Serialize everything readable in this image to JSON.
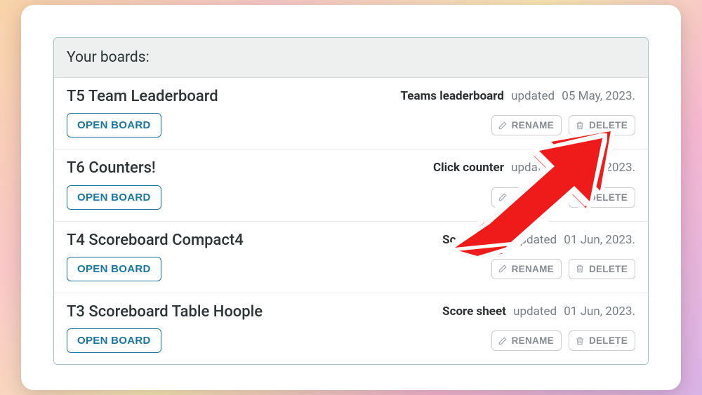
{
  "header_label": "Your boards:",
  "open_label": "OPEN BOARD",
  "rename_label": "RENAME",
  "delete_label": "DELETE",
  "updated_prefix": "updated",
  "boards": [
    {
      "title": "T5 Team Leaderboard",
      "type": "Teams leaderboard",
      "updated": "05 May, 2023."
    },
    {
      "title": "T6 Counters!",
      "type": "Click counter",
      "updated": "22 May, 2023."
    },
    {
      "title": "T4 Scoreboard Compact4",
      "type": "Score sheet",
      "updated": "01 Jun, 2023."
    },
    {
      "title": "T3 Scoreboard Table Hoople",
      "type": "Score sheet",
      "updated": "01 Jun, 2023."
    }
  ]
}
